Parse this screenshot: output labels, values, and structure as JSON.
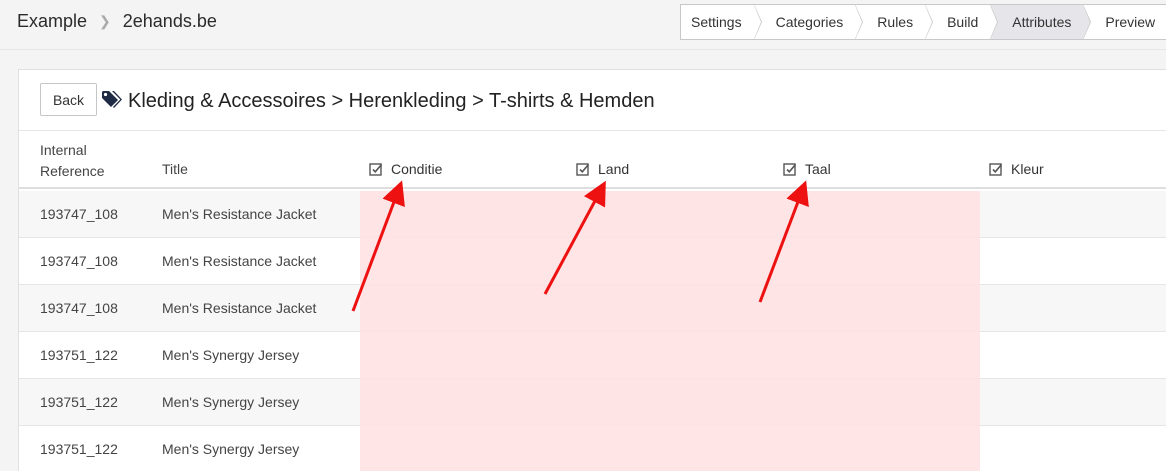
{
  "breadcrumb": {
    "root": "Example",
    "current": "2ehands.be"
  },
  "steps": [
    "Settings",
    "Categories",
    "Rules",
    "Build",
    "Attributes",
    "Preview"
  ],
  "active_step": "Attributes",
  "card": {
    "back_label": "Back",
    "category_path": "Kleding & Accessoires > Herenkleding > T-shirts & Hemden"
  },
  "table": {
    "headers": {
      "internal_reference": "Internal Reference",
      "title": "Title",
      "attributes": [
        "Conditie",
        "Land",
        "Taal",
        "Kleur"
      ]
    },
    "rows": [
      {
        "ref": "193747_108",
        "title": "Men's Resistance Jacket"
      },
      {
        "ref": "193747_108",
        "title": "Men's Resistance Jacket"
      },
      {
        "ref": "193747_108",
        "title": "Men's Resistance Jacket"
      },
      {
        "ref": "193751_122",
        "title": "Men's Synergy Jersey"
      },
      {
        "ref": "193751_122",
        "title": "Men's Synergy Jersey"
      },
      {
        "ref": "193751_122",
        "title": "Men's Synergy Jersey"
      }
    ]
  },
  "colors": {
    "highlight": "#ffe6e6",
    "arrow": "#ee1111",
    "active_step_bg": "#e6e6ea"
  },
  "icons": {
    "tag": "tag-icon",
    "checkbox": "checked-box-icon",
    "chevron": "chevron-right-icon"
  }
}
